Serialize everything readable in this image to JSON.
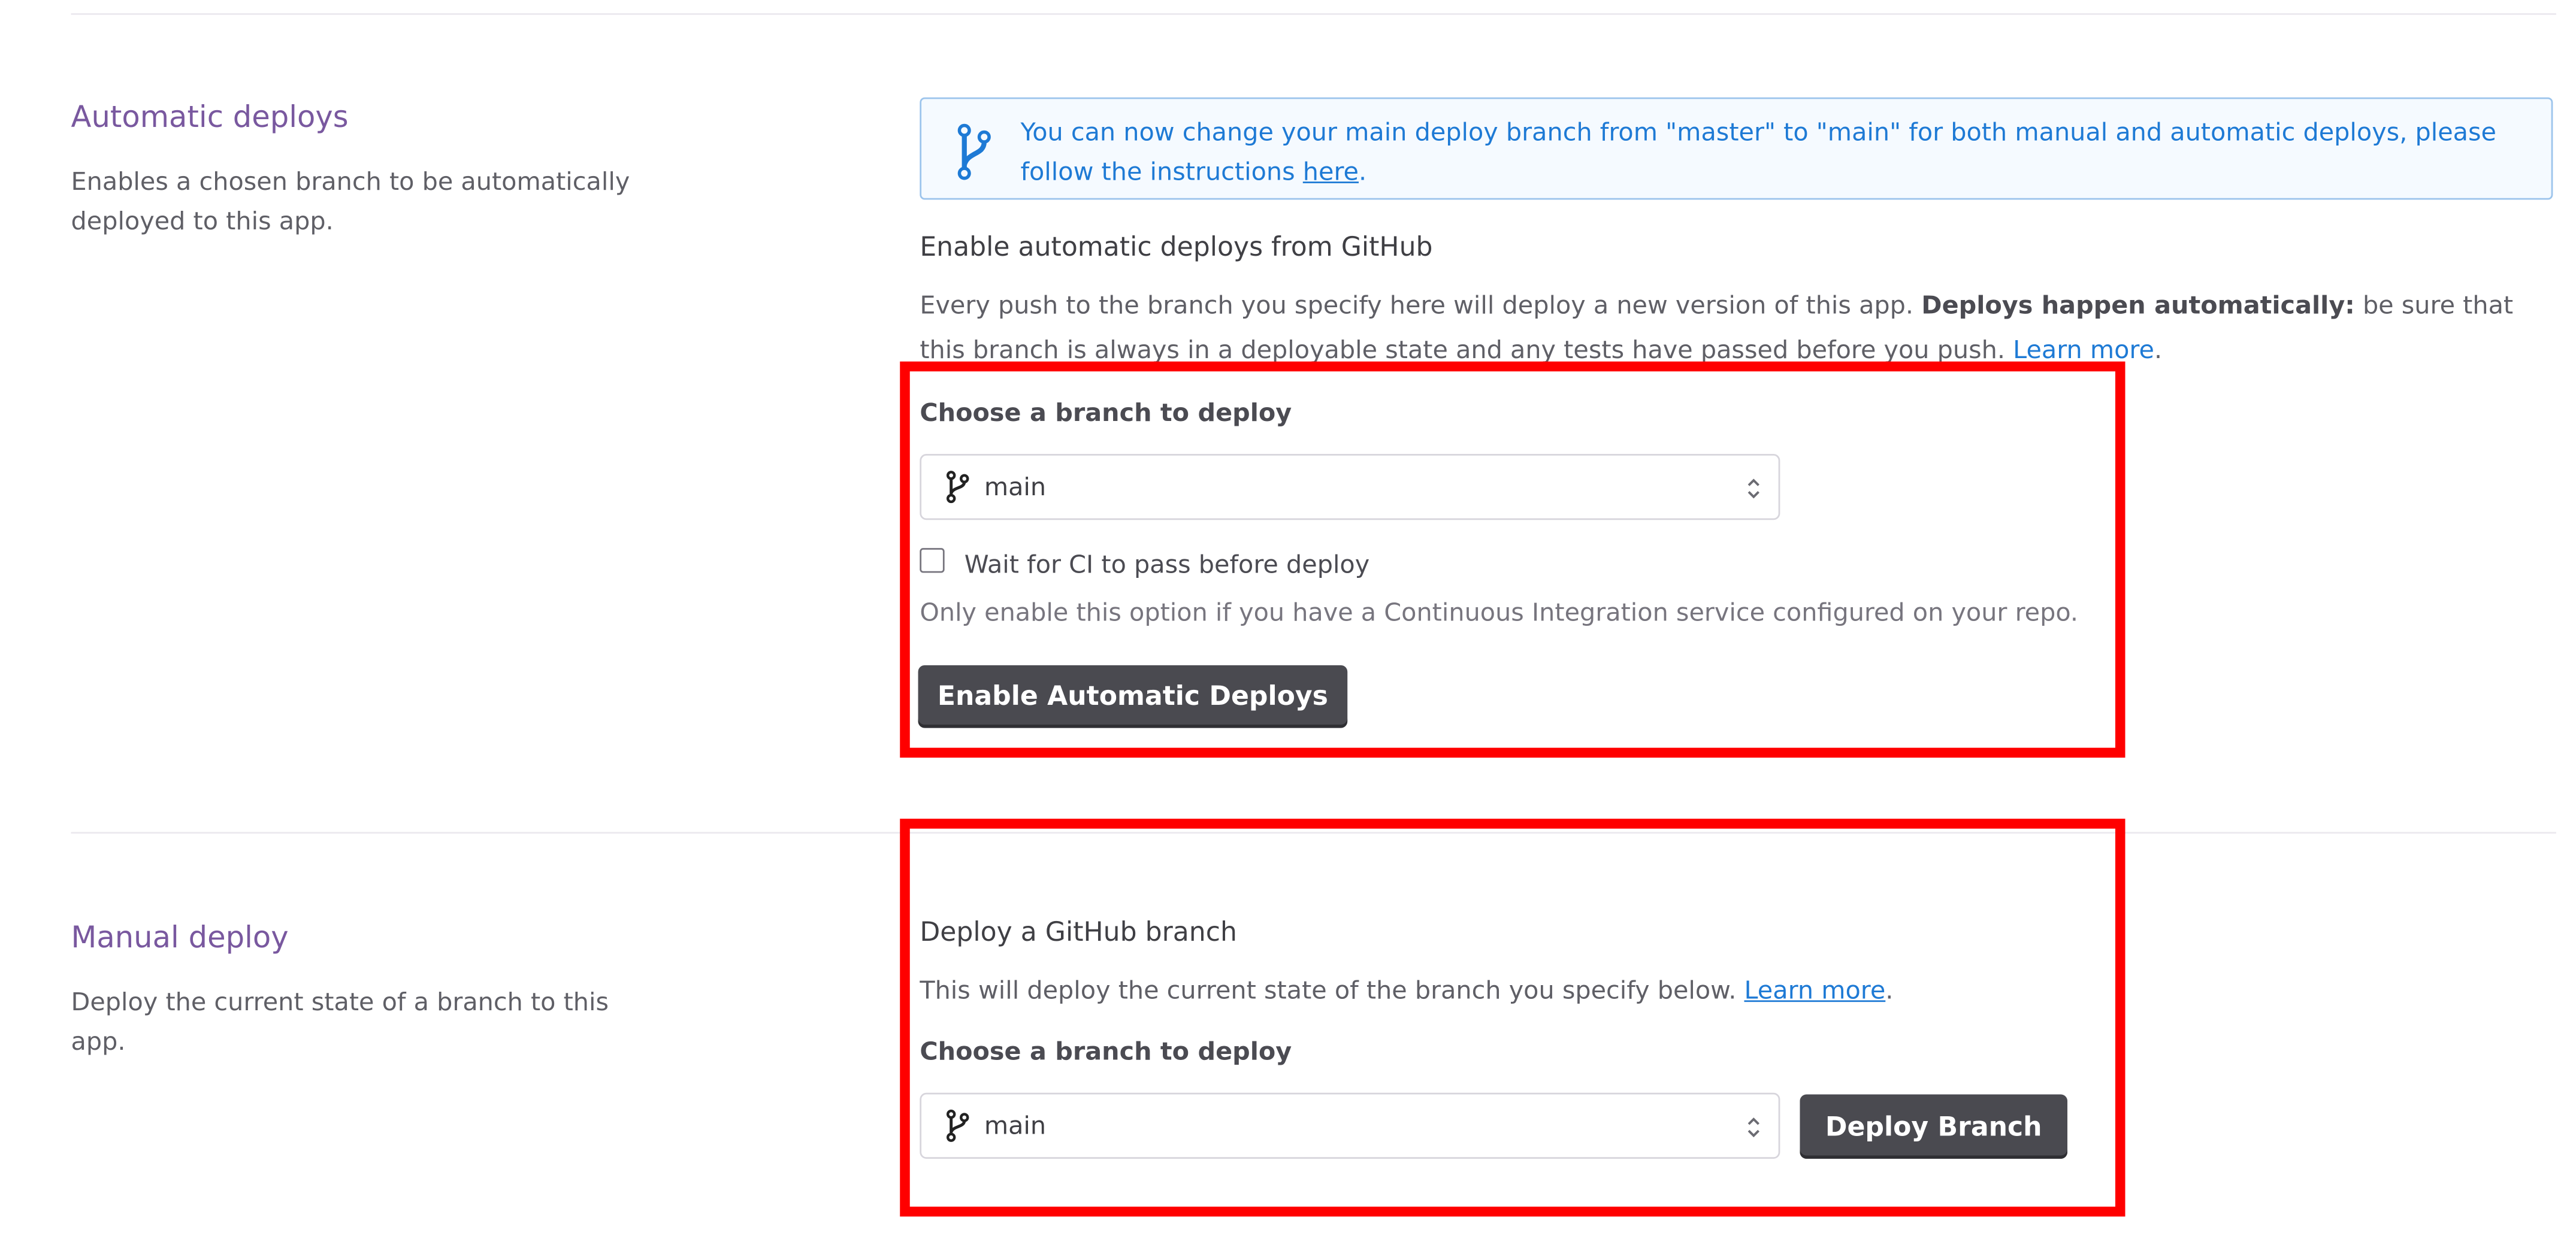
{
  "automatic": {
    "title": "Automatic deploys",
    "description": "Enables a chosen branch to be automatically deployed to this app.",
    "notice": {
      "text": "You can now change your main deploy branch from \"master\" to \"main\" for both manual and automatic deploys, please follow the instructions ",
      "link": "here",
      "after": "."
    },
    "heading": "Enable automatic deploys from GitHub",
    "body_before": "Every push to the branch you specify here will deploy a new version of this app. ",
    "body_bold": "Deploys happen automatically:",
    "body_after": " be sure that this branch is always in a deployable state and any tests have passed before you push. ",
    "learn_more": "Learn more",
    "learn_more_after": ".",
    "choose_label": "Choose a branch to deploy",
    "branch_value": "main",
    "ci_label": "Wait for CI to pass before deploy",
    "ci_hint": "Only enable this option if you have a Continuous Integration service configured on your repo.",
    "enable_button": "Enable Automatic Deploys"
  },
  "manual": {
    "title": "Manual deploy",
    "description": "Deploy the current state of a branch to this app.",
    "heading": "Deploy a GitHub branch",
    "body": "This will deploy the current state of the branch you specify below. ",
    "learn_more": "Learn more",
    "learn_more_after": ".",
    "choose_label": "Choose a branch to deploy",
    "branch_value": "main",
    "deploy_button": "Deploy Branch"
  },
  "colors": {
    "accent_purple": "#79589f",
    "link_blue": "#1e7ad5",
    "highlight_red": "#ff0000",
    "button_dark": "#4a4a50"
  },
  "icons": {
    "notice": "git-branch-icon",
    "select_branch": "git-branch-icon",
    "select_arrows": "chevron-up-down-icon"
  }
}
